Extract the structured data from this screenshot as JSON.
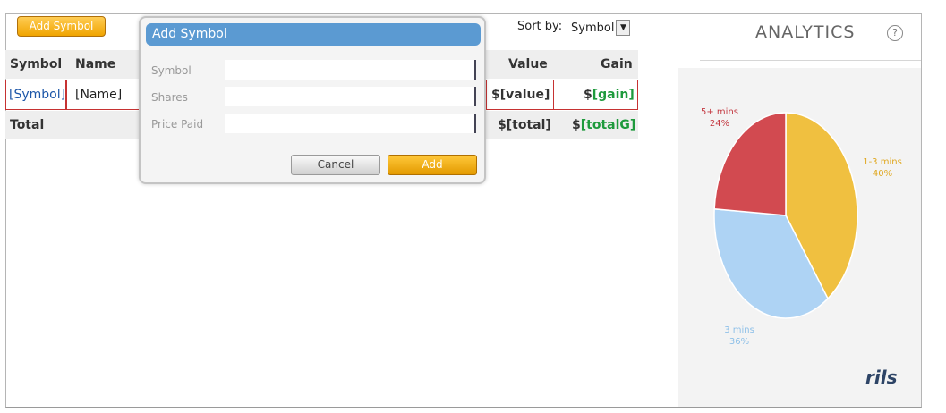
{
  "toolbar": {
    "add_symbol_label": "Add Symbol",
    "sort_label": "Sort by:",
    "sort_value": "Symbol"
  },
  "table": {
    "headers": [
      "Symbol",
      "Name",
      "Value",
      "Gain"
    ],
    "row": {
      "symbol": "[Symbol]",
      "name": "[Name]",
      "value": "$[value]",
      "gain_prefix": "$",
      "gain": "[gain]"
    },
    "total": {
      "label": "Total",
      "value": "$[total]",
      "gain_prefix": "$",
      "gain": "[totalG]"
    }
  },
  "dialog": {
    "title": "Add Symbol",
    "fields": [
      {
        "label": "Symbol",
        "value": ""
      },
      {
        "label": "Shares",
        "value": ""
      },
      {
        "label": "Price Paid",
        "value": ""
      }
    ],
    "cancel_label": "Cancel",
    "add_label": "Add"
  },
  "analytics": {
    "title": "ANALYTICS",
    "help_icon": "?",
    "logo": "rils"
  },
  "chart_data": {
    "type": "pie",
    "slices": [
      {
        "label": "1-3 mins",
        "pct_label": "40%",
        "value": 40,
        "color": "#f0c040"
      },
      {
        "label": "3 mins",
        "pct_label": "36%",
        "value": 36,
        "color": "#aed3f4"
      },
      {
        "label": "5+ mins",
        "pct_label": "24%",
        "value": 24,
        "color": "#d24a50"
      }
    ]
  }
}
